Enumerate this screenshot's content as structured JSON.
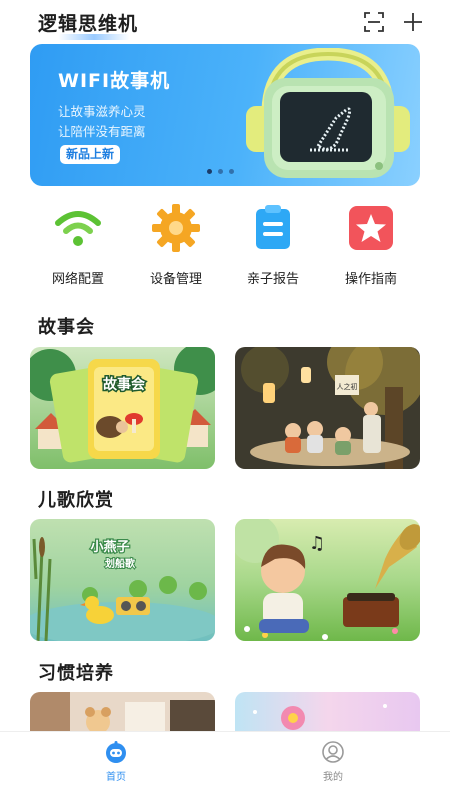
{
  "header": {
    "title": "逻辑思维机",
    "icons": [
      "scan-icon",
      "plus-icon"
    ]
  },
  "banner": {
    "title": "WIFI故事机",
    "subtitle_line1": "让故事滋养心灵",
    "subtitle_line2": "让陪伴没有距离",
    "badge": "新品上新",
    "carousel_dots": 3,
    "active_dot": 1
  },
  "quick_actions": [
    {
      "label": "网络配置",
      "icon": "wifi-icon",
      "color": "#5cc234"
    },
    {
      "label": "设备管理",
      "icon": "gear-icon",
      "color": "#f5a623"
    },
    {
      "label": "亲子报告",
      "icon": "report-icon",
      "color": "#2ea8f5"
    },
    {
      "label": "操作指南",
      "icon": "star-icon",
      "color": "#f2545b"
    }
  ],
  "sections": {
    "stories": {
      "title": "故事会",
      "cards": [
        {
          "image_text": "故事会"
        },
        {
          "image_text": "人之初"
        }
      ]
    },
    "songs": {
      "title": "儿歌欣赏",
      "cards": [
        {
          "image_text_line1": "小燕子",
          "image_text_line2": "划船歌"
        },
        {
          "image_text": ""
        }
      ]
    },
    "habits": {
      "title": "习惯培养"
    }
  },
  "tabbar": {
    "tabs": [
      {
        "label": "首页",
        "icon": "home-robot-icon",
        "active": true
      },
      {
        "label": "我的",
        "icon": "profile-icon",
        "active": false
      }
    ]
  },
  "colors": {
    "accent": "#2f8ff0",
    "banner": "#3aa6f6"
  }
}
